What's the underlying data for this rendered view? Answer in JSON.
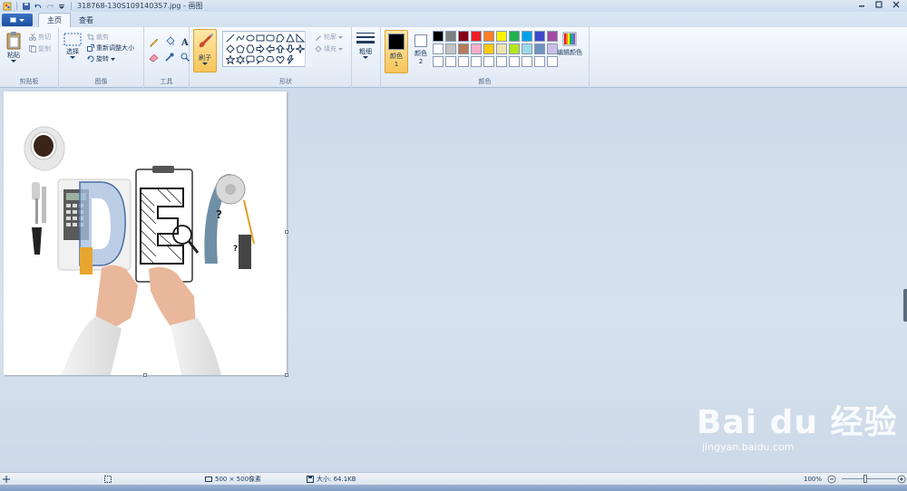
{
  "window": {
    "title": "318768-130S109140357.jpg - 画图",
    "controls": [
      "minimize-icon",
      "maximize-icon",
      "close-icon"
    ]
  },
  "tabs": [
    {
      "label": "主页",
      "active": true
    },
    {
      "label": "查看",
      "active": false
    }
  ],
  "ribbon": {
    "clipboard": {
      "label": "剪贴板",
      "paste": "粘贴",
      "cut": "剪切",
      "copy": "复制"
    },
    "image": {
      "label": "图像",
      "select": "选择",
      "crop": "裁剪",
      "resize": "重新调整大小",
      "rotate": "旋转"
    },
    "tools": {
      "label": "工具"
    },
    "brush": {
      "label": "刷子"
    },
    "shapes": {
      "label": "形状",
      "outline": "轮廓",
      "fill": "填充"
    },
    "size": {
      "label": "粗细"
    },
    "colors": {
      "label": "颜色",
      "color1": "颜色 1",
      "color2": "颜色 2",
      "edit": "编辑颜色",
      "color1_value": "#000000",
      "color2_value": "#ffffff",
      "palette": [
        "#000000",
        "#7f7f7f",
        "#880015",
        "#ed1c24",
        "#ff7f27",
        "#fff200",
        "#22b14c",
        "#00a2e8",
        "#3f48cc",
        "#a349a4",
        "#ffffff",
        "#c3c3c3",
        "#b97a57",
        "#ffaec9",
        "#ffc90e",
        "#efe4b0",
        "#b5e61d",
        "#99d9ea",
        "#7092be",
        "#c8bfe7",
        "#ffffff",
        "#ffffff",
        "#ffffff",
        "#ffffff",
        "#ffffff",
        "#ffffff",
        "#ffffff",
        "#ffffff",
        "#ffffff",
        "#ffffff"
      ]
    }
  },
  "canvas": {
    "image_description_icon": "idea-image"
  },
  "status": {
    "dimensions": "500 × 500像素",
    "size": "大小: 64.1KB",
    "zoom": "100%"
  },
  "watermark": {
    "main": "Bai du 经验",
    "sub": "jingyan.baidu.com"
  }
}
